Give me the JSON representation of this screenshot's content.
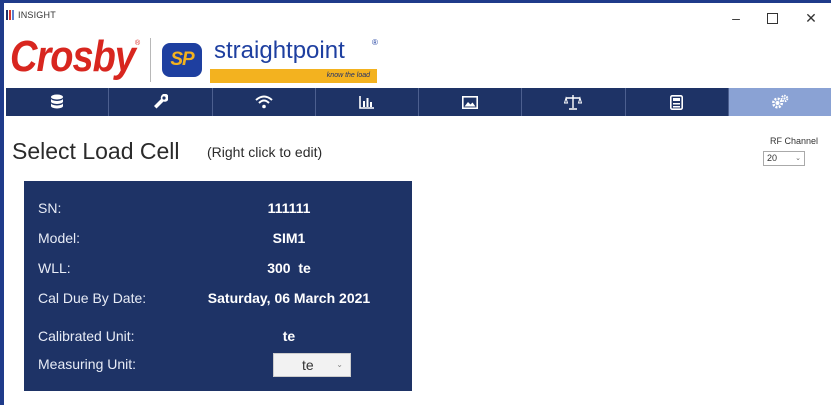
{
  "window": {
    "title": "INSIGHT",
    "controls": {
      "minimize": "–",
      "close": "✕"
    }
  },
  "branding": {
    "crosby": "Crosby",
    "sp_badge": "SP",
    "straightpoint": "straightpoint",
    "tagline": "know the load",
    "registered": "®"
  },
  "nav": {
    "items": [
      {
        "icon": "database-icon",
        "active": false
      },
      {
        "icon": "wrench-icon",
        "active": false
      },
      {
        "icon": "wifi-icon",
        "active": false
      },
      {
        "icon": "chart-icon",
        "active": false
      },
      {
        "icon": "image-icon",
        "active": false
      },
      {
        "icon": "scale-icon",
        "active": false
      },
      {
        "icon": "calculator-icon",
        "active": false
      },
      {
        "icon": "gears-icon",
        "active": true
      }
    ]
  },
  "page": {
    "title": "Select Load Cell",
    "hint": "(Right click to edit)"
  },
  "rf_channel": {
    "label": "RF Channel",
    "value": "20"
  },
  "load_cell": {
    "sn_label": "SN:",
    "sn": "111111",
    "model_label": "Model:",
    "model": "SIM1",
    "wll_label": "WLL:",
    "wll": "300  te",
    "cal_due_label": "Cal Due By Date:",
    "cal_due": "Saturday, 06 March 2021",
    "calibrated_unit_label": "Calibrated Unit:",
    "calibrated_unit": "te",
    "measuring_unit_label": "Measuring Unit:",
    "measuring_unit": "te"
  },
  "colors": {
    "nav_bg": "#1e3366",
    "nav_active": "#8aa2d4",
    "card_bg": "#1e3366",
    "crosby_red": "#d8261f",
    "sp_blue": "#1e3fa0",
    "sp_yellow": "#f3b21f"
  }
}
